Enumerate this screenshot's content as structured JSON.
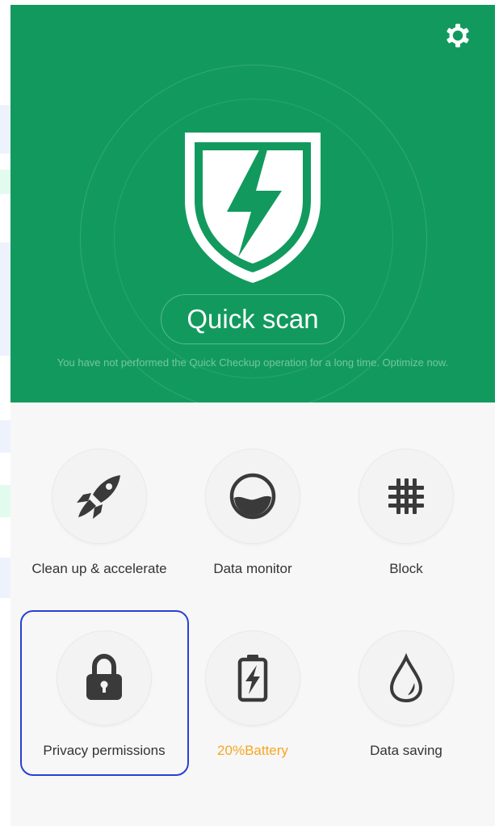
{
  "header": {
    "settings_icon": "gear-icon",
    "shield_icon": "shield-lightning-icon",
    "quick_scan_label": "Quick scan",
    "hint_text": "You have not performed the Quick Checkup operation for a long time. Optimize now."
  },
  "tools": [
    {
      "label": "Clean up & accelerate",
      "icon": "rocket-icon"
    },
    {
      "label": "Data monitor",
      "icon": "gauge-icon"
    },
    {
      "label": "Block",
      "icon": "hash-grid-icon"
    },
    {
      "label": "Privacy permissions",
      "icon": "lock-icon"
    },
    {
      "label": "20%Battery",
      "icon": "battery-icon"
    },
    {
      "label": "Data saving",
      "icon": "drop-icon"
    }
  ],
  "colors": {
    "header_green": "#129a5e",
    "battery_label": "#f5a623",
    "selection_outline": "#2a3fd4",
    "icon_dark": "#3a3a3a"
  }
}
